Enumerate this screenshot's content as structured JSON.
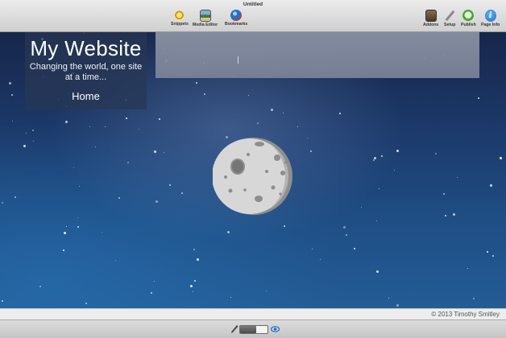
{
  "window": {
    "title": "Untitled"
  },
  "toolbar": {
    "left_items": [
      {
        "label": "Snippets",
        "icon": "snippets-icon"
      },
      {
        "label": "Media Editor",
        "icon": "media-editor-icon"
      },
      {
        "label": "Bookmarks",
        "icon": "bookmarks-icon"
      }
    ],
    "right_items": [
      {
        "label": "Addons",
        "icon": "addons-icon"
      },
      {
        "label": "Setup",
        "icon": "setup-icon"
      },
      {
        "label": "Publish",
        "icon": "publish-icon"
      },
      {
        "label": "Page Info",
        "icon": "info-icon"
      }
    ]
  },
  "site": {
    "title": "My Website",
    "tagline": "Changing the world, one site at a time...",
    "nav": [
      {
        "label": "Home"
      }
    ],
    "footer_text": "© 2013 Timothy Smitley",
    "image": "moon-illustration"
  },
  "bottom_bar": {
    "left_icon": "pencil-icon",
    "right_icon": "eye-icon",
    "mode": "edit"
  },
  "colors": {
    "sky_top": "#17264a",
    "sky_bottom": "#245c95",
    "moon_face": "#d7d7d7",
    "moon_shadow": "#8f8f8f"
  }
}
